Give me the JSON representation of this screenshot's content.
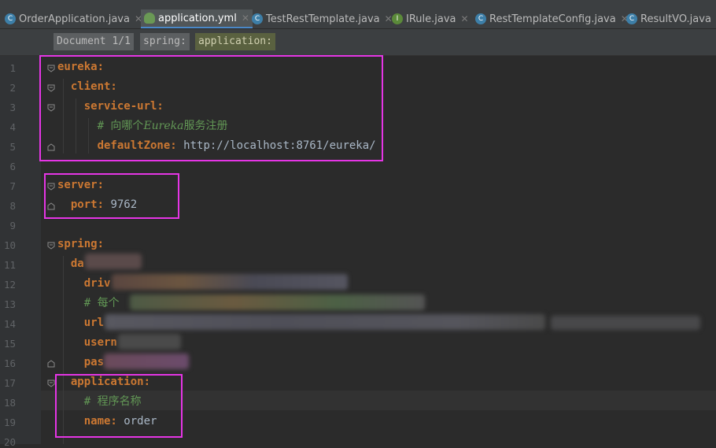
{
  "tabs": [
    {
      "label": "OrderApplication.java",
      "icon": "spring-app-class-icon"
    },
    {
      "label": "application.yml",
      "icon": "yaml-file-icon",
      "active": true
    },
    {
      "label": "TestRestTemplate.java",
      "icon": "class-icon"
    },
    {
      "label": "IRule.java",
      "icon": "interface-icon"
    },
    {
      "label": "RestTemplateConfig.java",
      "icon": "class-icon"
    },
    {
      "label": "ResultVO.java",
      "icon": "class-icon"
    }
  ],
  "breadcrumb": [
    "Document 1/1",
    "spring:",
    "application:"
  ],
  "lines": {
    "l1": {
      "key": "eureka:"
    },
    "l2": {
      "key": "client:"
    },
    "l3": {
      "key": "service-url:"
    },
    "l4": {
      "comment_pre": "# 向哪个",
      "comment_em": "Eureka",
      "comment_post": "服务注册"
    },
    "l5": {
      "key": "defaultZone:",
      "value": " http://localhost:8761/eureka/"
    },
    "l7": {
      "key": "server:"
    },
    "l8": {
      "key": "port:",
      "value": " 9762"
    },
    "l10": {
      "key": "spring:"
    },
    "l11": {
      "key": "da"
    },
    "l12": {
      "key": "driv"
    },
    "l13": {
      "comment": "# 每个"
    },
    "l14": {
      "key": "url",
      "tail": "ng="
    },
    "l15": {
      "key": "usern"
    },
    "l16": {
      "key": "pas"
    },
    "l17": {
      "key": "application:"
    },
    "l18": {
      "comment": "# 程序名称"
    },
    "l19": {
      "key": "name:",
      "value": " order"
    }
  },
  "line_numbers": [
    "1",
    "2",
    "3",
    "4",
    "5",
    "6",
    "7",
    "8",
    "9",
    "10",
    "11",
    "12",
    "13",
    "14",
    "15",
    "16",
    "17",
    "18",
    "19",
    "20"
  ]
}
